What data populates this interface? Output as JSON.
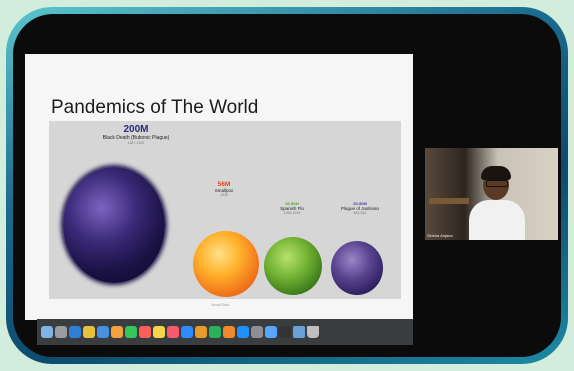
{
  "slide": {
    "title": "Pandemics of The World",
    "pandemics": [
      {
        "count": "200M",
        "name": "Black Death (Bubonic Plague)",
        "years": "1347-1351"
      },
      {
        "count": "56M",
        "name": "Smallpox",
        "years": "1520"
      },
      {
        "count": "40-50M",
        "name": "Spanish Flu",
        "years": "1918-1919"
      },
      {
        "count": "30-50M",
        "name": "Plague of Justinian",
        "years": "541-542"
      }
    ],
    "caption": "Visual Data"
  },
  "participant": {
    "name_tag": "Sirisha Anjana"
  },
  "colors": {
    "background": "#d3eddc",
    "frame_accent": "#1b6d8f",
    "black_death": "#3a2a78",
    "smallpox": "#f2731b",
    "spanish_flu": "#72b234",
    "justinian": "#5a4490"
  },
  "dock": {
    "icons": [
      "finder-icon",
      "launchpad-icon",
      "safari-icon",
      "chrome-icon",
      "mail-icon",
      "photos-icon",
      "messages-icon",
      "calendar-icon",
      "notes-icon",
      "music-icon",
      "zoom-icon",
      "keynote-icon",
      "numbers-icon",
      "pages-icon",
      "app-store-icon",
      "system-preferences-icon",
      "preview-icon",
      "terminal-icon",
      "folder-icon",
      "trash-icon"
    ]
  }
}
